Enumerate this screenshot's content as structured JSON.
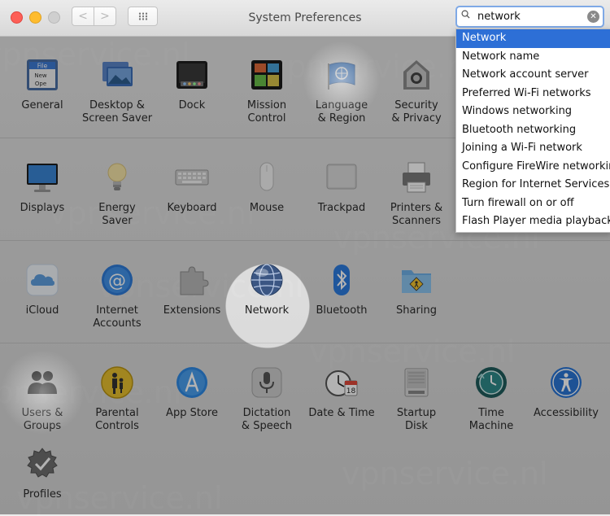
{
  "window": {
    "title": "System Preferences",
    "nav_back_symbol": "<",
    "nav_forward_symbol": ">"
  },
  "search": {
    "value": "network",
    "clear_symbol": "✕"
  },
  "suggestions": [
    "Network",
    "Network name",
    "Network account server",
    "Preferred Wi-Fi networks",
    "Windows networking",
    "Bluetooth networking",
    "Joining a Wi-Fi network",
    "Configure FireWire networking",
    "Region for Internet Services",
    "Turn firewall on or off",
    "Flash Player media playback"
  ],
  "rows": [
    {
      "panes": [
        {
          "label": "General",
          "icon": "general-icon"
        },
        {
          "label": "Desktop &\nScreen Saver",
          "icon": "desktop-icon"
        },
        {
          "label": "Dock",
          "icon": "dock-icon"
        },
        {
          "label": "Mission\nControl",
          "icon": "mission-control-icon"
        },
        {
          "label": "Language\n& Region",
          "icon": "language-region-icon"
        },
        {
          "label": "Security\n& Privacy",
          "icon": "security-icon"
        }
      ]
    },
    {
      "panes": [
        {
          "label": "Displays",
          "icon": "displays-icon"
        },
        {
          "label": "Energy\nSaver",
          "icon": "energy-saver-icon"
        },
        {
          "label": "Keyboard",
          "icon": "keyboard-icon"
        },
        {
          "label": "Mouse",
          "icon": "mouse-icon"
        },
        {
          "label": "Trackpad",
          "icon": "trackpad-icon"
        },
        {
          "label": "Printers &\nScanners",
          "icon": "printer-icon"
        }
      ]
    },
    {
      "panes": [
        {
          "label": "iCloud",
          "icon": "icloud-icon"
        },
        {
          "label": "Internet\nAccounts",
          "icon": "internet-accounts-icon"
        },
        {
          "label": "Extensions",
          "icon": "extensions-icon"
        },
        {
          "label": "Network",
          "icon": "network-icon"
        },
        {
          "label": "Bluetooth",
          "icon": "bluetooth-icon"
        },
        {
          "label": "Sharing",
          "icon": "sharing-icon"
        }
      ]
    },
    {
      "panes": [
        {
          "label": "Users &\nGroups",
          "icon": "users-groups-icon"
        },
        {
          "label": "Parental\nControls",
          "icon": "parental-controls-icon"
        },
        {
          "label": "App Store",
          "icon": "app-store-icon"
        },
        {
          "label": "Dictation\n& Speech",
          "icon": "dictation-icon"
        },
        {
          "label": "Date & Time",
          "icon": "date-time-icon"
        },
        {
          "label": "Startup\nDisk",
          "icon": "startup-disk-icon"
        },
        {
          "label": "Time\nMachine",
          "icon": "time-machine-icon"
        },
        {
          "label": "Accessibility",
          "icon": "accessibility-icon"
        }
      ]
    },
    {
      "panes": [
        {
          "label": "Profiles",
          "icon": "profiles-icon"
        }
      ]
    }
  ],
  "watermark": "vpnservice.nl"
}
